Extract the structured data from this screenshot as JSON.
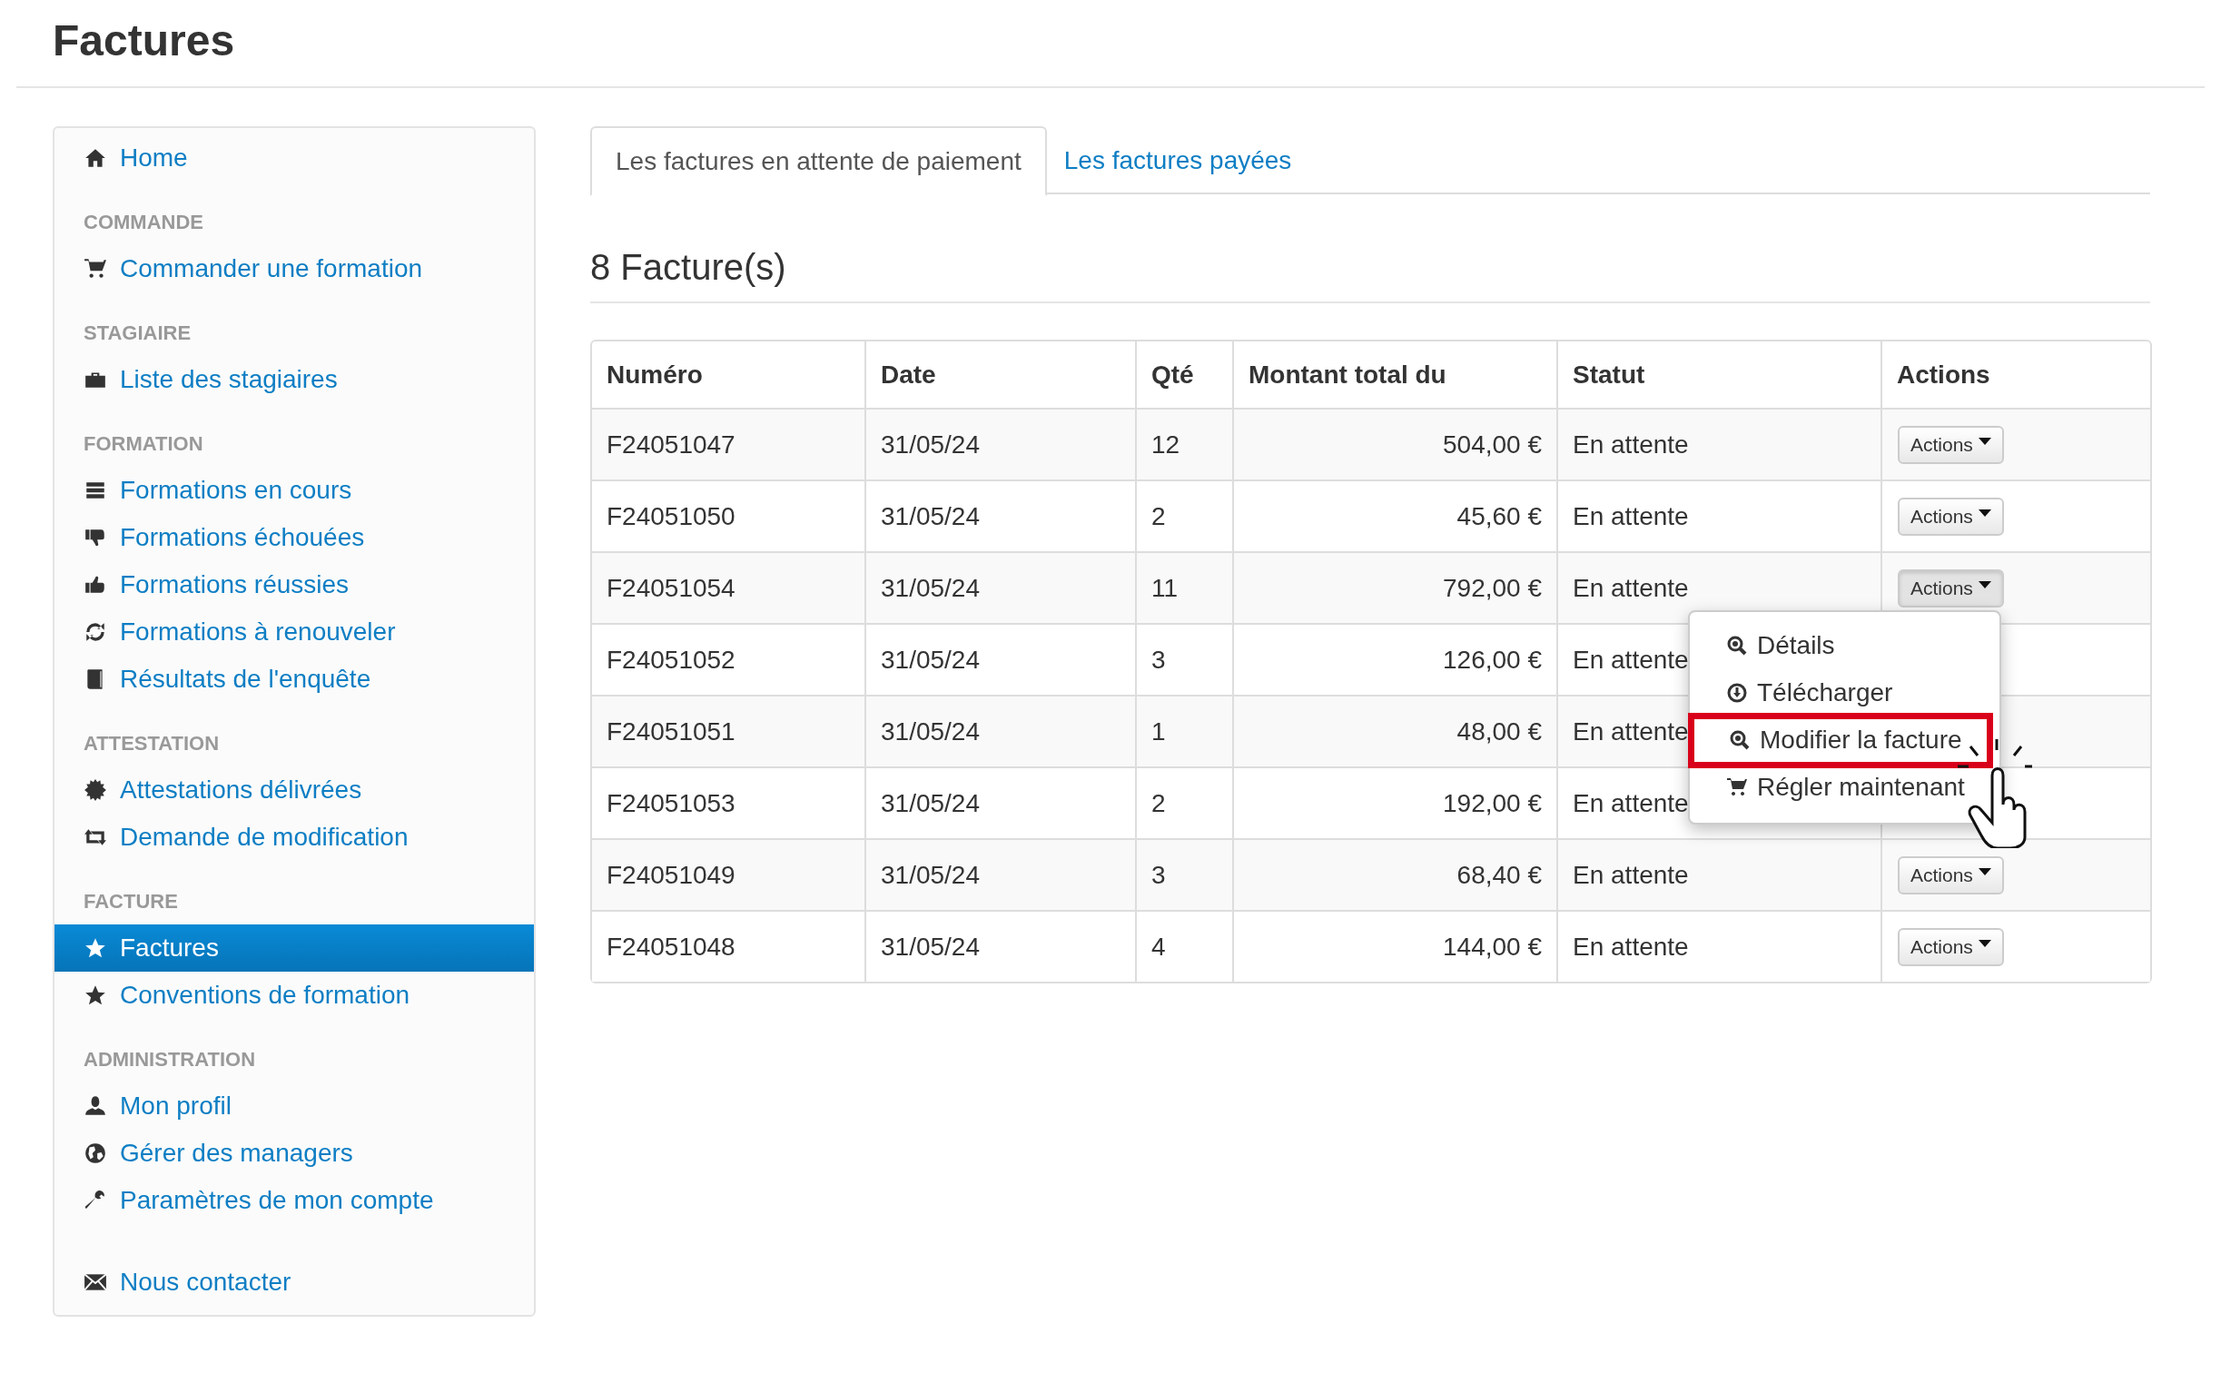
{
  "page_title": "Factures",
  "sidebar": {
    "items": [
      {
        "kind": "link",
        "label": "Home",
        "selected": false
      },
      {
        "kind": "header",
        "label": "COMMANDE"
      },
      {
        "kind": "link",
        "label": "Commander une formation",
        "selected": false
      },
      {
        "kind": "header",
        "label": "STAGIAIRE"
      },
      {
        "kind": "link",
        "label": "Liste des stagiaires",
        "selected": false
      },
      {
        "kind": "header",
        "label": "FORMATION"
      },
      {
        "kind": "link",
        "label": "Formations en cours",
        "selected": false
      },
      {
        "kind": "link",
        "label": "Formations échouées",
        "selected": false
      },
      {
        "kind": "link",
        "label": "Formations réussies",
        "selected": false
      },
      {
        "kind": "link",
        "label": "Formations à renouveler",
        "selected": false
      },
      {
        "kind": "link",
        "label": "Résultats de l'enquête",
        "selected": false
      },
      {
        "kind": "header",
        "label": "ATTESTATION"
      },
      {
        "kind": "link",
        "label": "Attestations délivrées",
        "selected": false
      },
      {
        "kind": "link",
        "label": "Demande de modification",
        "selected": false
      },
      {
        "kind": "header",
        "label": "FACTURE"
      },
      {
        "kind": "link",
        "label": "Factures",
        "selected": true
      },
      {
        "kind": "link",
        "label": "Conventions de formation",
        "selected": false
      },
      {
        "kind": "header",
        "label": "ADMINISTRATION"
      },
      {
        "kind": "link",
        "label": "Mon profil",
        "selected": false
      },
      {
        "kind": "link",
        "label": "Gérer des managers",
        "selected": false
      },
      {
        "kind": "link",
        "label": "Paramètres de mon compte",
        "selected": false
      }
    ],
    "footer_link": {
      "label": "Nous contacter"
    }
  },
  "tabs": [
    {
      "label": "Les factures en attente de paiement",
      "selected": true
    },
    {
      "label": "Les factures payées",
      "selected": false
    }
  ],
  "heading": "8 Facture(s)",
  "table": {
    "columns": [
      "Numéro",
      "Date",
      "Qté",
      "Montant total du",
      "Statut",
      "Actions"
    ],
    "rows": [
      {
        "cells": [
          "F24051047",
          "31/05/24",
          "12",
          "504,00 €",
          "En attente"
        ],
        "action": {
          "label": "Actions",
          "pressed": false
        }
      },
      {
        "cells": [
          "F24051050",
          "31/05/24",
          "2",
          "45,60 €",
          "En attente"
        ],
        "action": {
          "label": "Actions",
          "pressed": false
        }
      },
      {
        "cells": [
          "F24051054",
          "31/05/24",
          "11",
          "792,00 €",
          "En attente"
        ],
        "action": {
          "label": "Actions",
          "pressed": true
        }
      },
      {
        "cells": [
          "F24051052",
          "31/05/24",
          "3",
          "126,00 €",
          "En attente"
        ]
      },
      {
        "cells": [
          "F24051051",
          "31/05/24",
          "1",
          "48,00 €",
          "En attente"
        ]
      },
      {
        "cells": [
          "F24051053",
          "31/05/24",
          "2",
          "192,00 €",
          "En attente"
        ]
      },
      {
        "cells": [
          "F24051049",
          "31/05/24",
          "3",
          "68,40 €",
          "En attente"
        ],
        "action": {
          "label": "Actions",
          "pressed": false
        }
      },
      {
        "cells": [
          "F24051048",
          "31/05/24",
          "4",
          "144,00 €",
          "En attente"
        ],
        "action": {
          "label": "Actions",
          "pressed": false
        }
      }
    ]
  },
  "dropdown_menu": {
    "items": [
      {
        "label": "Détails",
        "highlighted": false
      },
      {
        "label": "Télécharger",
        "highlighted": false
      },
      {
        "label": "Modifier la facture",
        "highlighted": true
      },
      {
        "label": "Régler maintenant",
        "highlighted": false
      }
    ]
  }
}
